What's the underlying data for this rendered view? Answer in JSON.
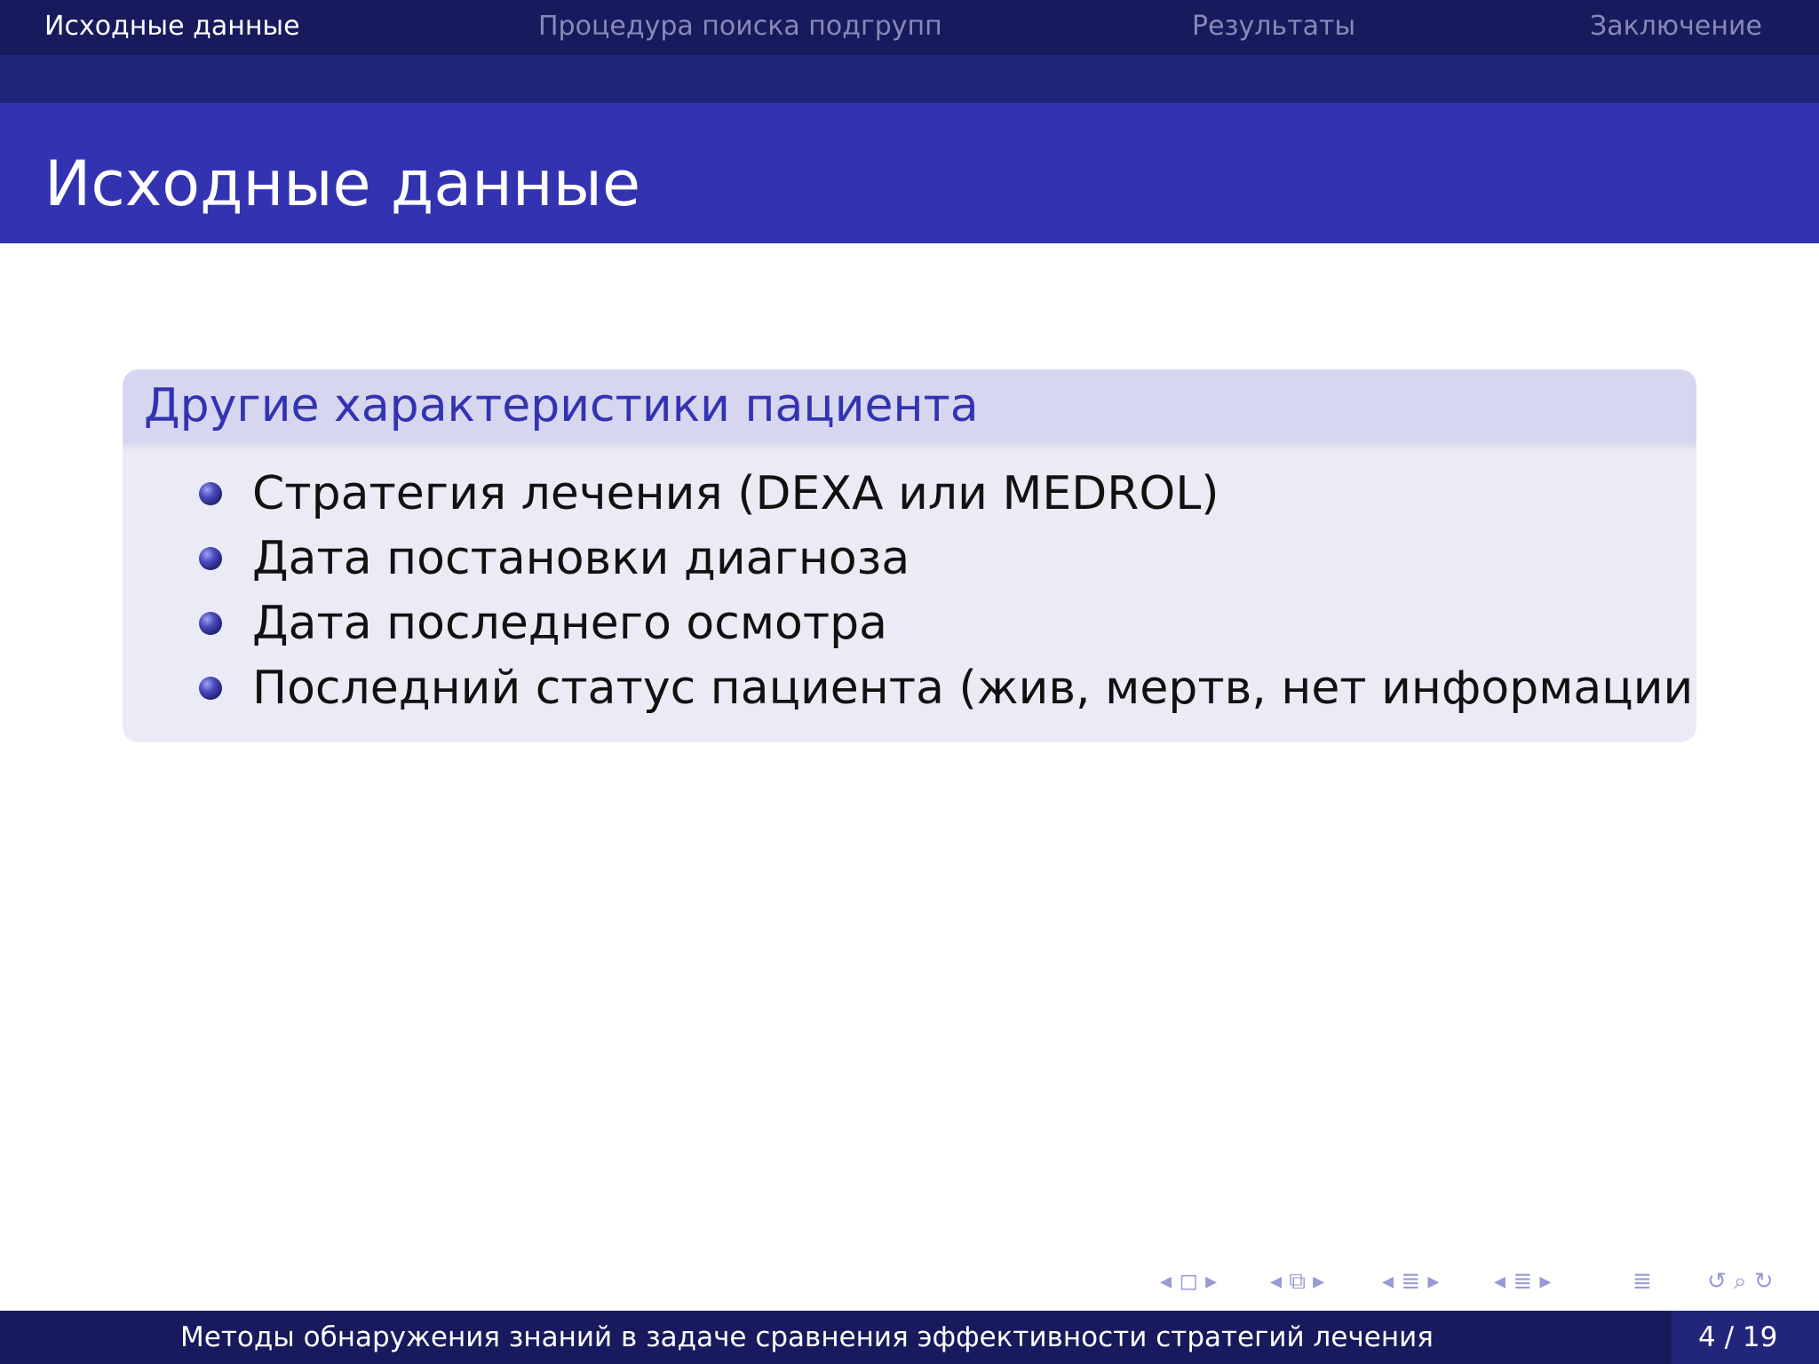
{
  "nav": {
    "sections": [
      "Исходные данные",
      "Процедура поиска подгрупп",
      "Результаты",
      "Заключение"
    ],
    "active_index": 0
  },
  "frame": {
    "title": "Исходные данные"
  },
  "block": {
    "title": "Другие характеристики пациента",
    "items": [
      "Стратегия лечения (DEXA или MEDROL)",
      "Дата постановки диагноза",
      "Дата последнего осмотра",
      "Последний статус пациента (жив, мертв, нет информации)"
    ]
  },
  "footer": {
    "title": "Методы обнаружения знаний в задаче сравнения эффективности стратегий лечения",
    "page": "4 / 19"
  },
  "nav_controls": {
    "frame": "◂ ◻ ▸",
    "subsection": "◂ ⧉ ▸",
    "section": "◂ ≣ ▸",
    "part": "◂ ≣ ▸",
    "appendix": "≣",
    "tools": "↺ ⌕ ↻"
  },
  "colors": {
    "header_dark": "#171a5c",
    "header_mid": "#22267a",
    "title_bar": "#3333b2",
    "block_header": "#d6d6f0",
    "block_body": "#ebebf6",
    "accent": "#3333b2"
  }
}
